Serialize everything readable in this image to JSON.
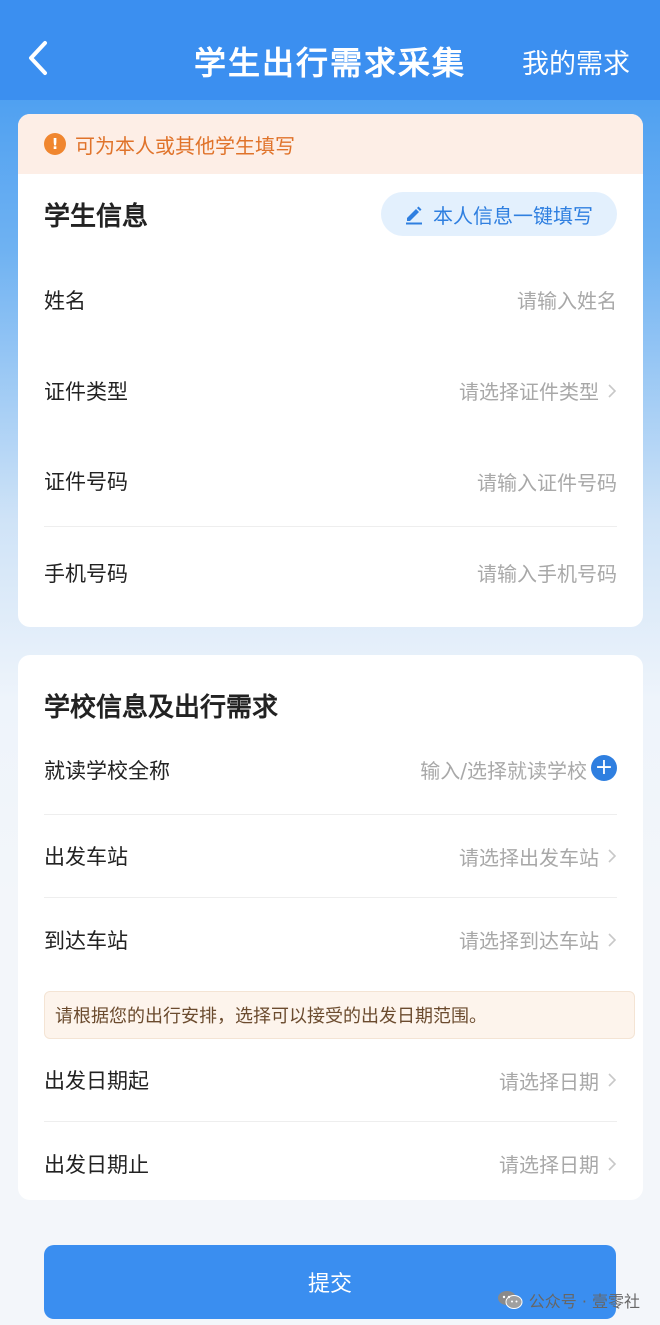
{
  "header": {
    "title": "学生出行需求采集",
    "right_link": "我的需求"
  },
  "student_card": {
    "notice": "可为本人或其他学生填写",
    "title": "学生信息",
    "quick_fill": "本人信息一键填写",
    "fields": [
      {
        "label": "姓名",
        "placeholder": "请输入姓名"
      },
      {
        "label": "证件类型",
        "placeholder": "请选择证件类型"
      },
      {
        "label": "证件号码",
        "placeholder": "请输入证件号码"
      },
      {
        "label": "手机号码",
        "placeholder": "请输入手机号码"
      }
    ]
  },
  "school_card": {
    "title": "学校信息及出行需求",
    "fields": [
      {
        "label": "就读学校全称",
        "placeholder": "输入/选择就读学校"
      },
      {
        "label": "出发车站",
        "placeholder": "请选择出发车站"
      },
      {
        "label": "到达车站",
        "placeholder": "请选择到达车站"
      }
    ],
    "tip": "请根据您的出行安排，选择可以接受的出发日期范围。",
    "date_fields": [
      {
        "label": "出发日期起",
        "placeholder": "请选择日期"
      },
      {
        "label": "出发日期止",
        "placeholder": "请选择日期"
      }
    ]
  },
  "submit_label": "提交",
  "watermark": "公众号 · 壹零社",
  "colors": {
    "primary": "#3b8ff0",
    "notice_text": "#e0732a",
    "placeholder": "#a8a8a8"
  }
}
